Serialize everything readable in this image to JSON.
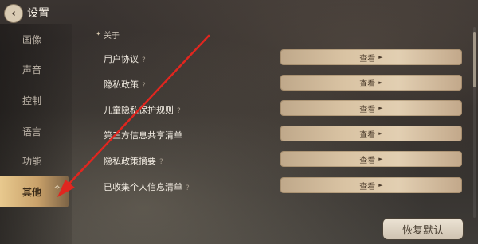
{
  "header": {
    "title": "设置",
    "back_icon": "chevron-left-icon"
  },
  "sidebar": {
    "items": [
      {
        "label": "画像"
      },
      {
        "label": "声音"
      },
      {
        "label": "控制"
      },
      {
        "label": "语言"
      },
      {
        "label": "功能"
      },
      {
        "label": "其他",
        "active": true
      }
    ]
  },
  "section": {
    "title": "关于",
    "marker": "✦"
  },
  "rows": [
    {
      "label": "用户协议",
      "hint": "?",
      "button": "查看"
    },
    {
      "label": "隐私政策",
      "hint": "?",
      "button": "查看"
    },
    {
      "label": "儿童隐私保护规则",
      "hint": "?",
      "button": "查看"
    },
    {
      "label": "第三方信息共享清单",
      "hint": "",
      "button": "查看"
    },
    {
      "label": "隐私政策摘要",
      "hint": "?",
      "button": "查看"
    },
    {
      "label": "已收集个人信息清单",
      "hint": "?",
      "button": "查看"
    }
  ],
  "reset_button": "恢复默认",
  "colors": {
    "accent_gold": "#c9a16a",
    "annotation_red": "#e0261f"
  }
}
